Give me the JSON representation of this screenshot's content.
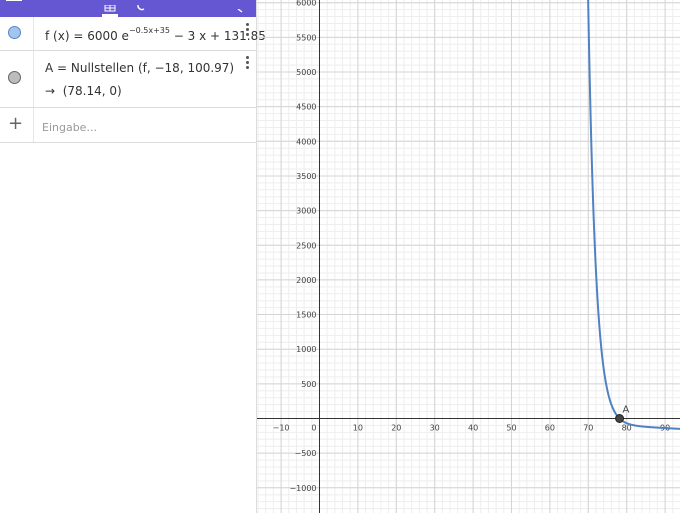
{
  "algebra": {
    "rows": [
      {
        "name": "f",
        "expression_prefix": "f (x)  =  6000 e",
        "exponent": "−0.5x+35",
        "expression_suffix": " − 3 x + 131.85"
      },
      {
        "name": "A",
        "expression": "A = Nullstellen (f, −18, 100.97)",
        "arrow": "→",
        "result": "(78.14, 0)"
      }
    ],
    "input_placeholder": "Eingabe...",
    "add_symbol": "+"
  },
  "graphics": {
    "point_label": "A",
    "x_ticks": [
      -10,
      0,
      10,
      20,
      30,
      40,
      50,
      60,
      70,
      80,
      90
    ],
    "y_ticks": [
      6000,
      5500,
      5000,
      4500,
      4000,
      3500,
      3000,
      2500,
      2000,
      1500,
      1000,
      500,
      -500,
      -1000
    ],
    "point": [
      78.14,
      0
    ],
    "curve_color": "#4f82c2",
    "point_color": "#444444",
    "accent_color": "#6557d2"
  }
}
